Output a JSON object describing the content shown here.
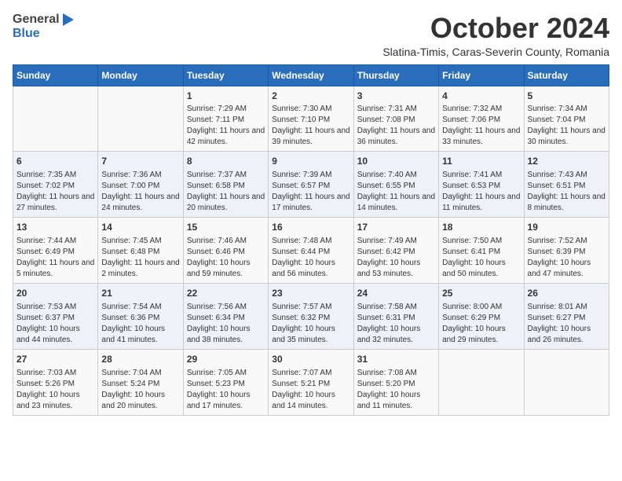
{
  "logo": {
    "line1": "General",
    "line2": "Blue"
  },
  "title": "October 2024",
  "subtitle": "Slatina-Timis, Caras-Severin County, Romania",
  "weekdays": [
    "Sunday",
    "Monday",
    "Tuesday",
    "Wednesday",
    "Thursday",
    "Friday",
    "Saturday"
  ],
  "weeks": [
    [
      {
        "day": "",
        "info": ""
      },
      {
        "day": "",
        "info": ""
      },
      {
        "day": "1",
        "info": "Sunrise: 7:29 AM\nSunset: 7:11 PM\nDaylight: 11 hours and 42 minutes."
      },
      {
        "day": "2",
        "info": "Sunrise: 7:30 AM\nSunset: 7:10 PM\nDaylight: 11 hours and 39 minutes."
      },
      {
        "day": "3",
        "info": "Sunrise: 7:31 AM\nSunset: 7:08 PM\nDaylight: 11 hours and 36 minutes."
      },
      {
        "day": "4",
        "info": "Sunrise: 7:32 AM\nSunset: 7:06 PM\nDaylight: 11 hours and 33 minutes."
      },
      {
        "day": "5",
        "info": "Sunrise: 7:34 AM\nSunset: 7:04 PM\nDaylight: 11 hours and 30 minutes."
      }
    ],
    [
      {
        "day": "6",
        "info": "Sunrise: 7:35 AM\nSunset: 7:02 PM\nDaylight: 11 hours and 27 minutes."
      },
      {
        "day": "7",
        "info": "Sunrise: 7:36 AM\nSunset: 7:00 PM\nDaylight: 11 hours and 24 minutes."
      },
      {
        "day": "8",
        "info": "Sunrise: 7:37 AM\nSunset: 6:58 PM\nDaylight: 11 hours and 20 minutes."
      },
      {
        "day": "9",
        "info": "Sunrise: 7:39 AM\nSunset: 6:57 PM\nDaylight: 11 hours and 17 minutes."
      },
      {
        "day": "10",
        "info": "Sunrise: 7:40 AM\nSunset: 6:55 PM\nDaylight: 11 hours and 14 minutes."
      },
      {
        "day": "11",
        "info": "Sunrise: 7:41 AM\nSunset: 6:53 PM\nDaylight: 11 hours and 11 minutes."
      },
      {
        "day": "12",
        "info": "Sunrise: 7:43 AM\nSunset: 6:51 PM\nDaylight: 11 hours and 8 minutes."
      }
    ],
    [
      {
        "day": "13",
        "info": "Sunrise: 7:44 AM\nSunset: 6:49 PM\nDaylight: 11 hours and 5 minutes."
      },
      {
        "day": "14",
        "info": "Sunrise: 7:45 AM\nSunset: 6:48 PM\nDaylight: 11 hours and 2 minutes."
      },
      {
        "day": "15",
        "info": "Sunrise: 7:46 AM\nSunset: 6:46 PM\nDaylight: 10 hours and 59 minutes."
      },
      {
        "day": "16",
        "info": "Sunrise: 7:48 AM\nSunset: 6:44 PM\nDaylight: 10 hours and 56 minutes."
      },
      {
        "day": "17",
        "info": "Sunrise: 7:49 AM\nSunset: 6:42 PM\nDaylight: 10 hours and 53 minutes."
      },
      {
        "day": "18",
        "info": "Sunrise: 7:50 AM\nSunset: 6:41 PM\nDaylight: 10 hours and 50 minutes."
      },
      {
        "day": "19",
        "info": "Sunrise: 7:52 AM\nSunset: 6:39 PM\nDaylight: 10 hours and 47 minutes."
      }
    ],
    [
      {
        "day": "20",
        "info": "Sunrise: 7:53 AM\nSunset: 6:37 PM\nDaylight: 10 hours and 44 minutes."
      },
      {
        "day": "21",
        "info": "Sunrise: 7:54 AM\nSunset: 6:36 PM\nDaylight: 10 hours and 41 minutes."
      },
      {
        "day": "22",
        "info": "Sunrise: 7:56 AM\nSunset: 6:34 PM\nDaylight: 10 hours and 38 minutes."
      },
      {
        "day": "23",
        "info": "Sunrise: 7:57 AM\nSunset: 6:32 PM\nDaylight: 10 hours and 35 minutes."
      },
      {
        "day": "24",
        "info": "Sunrise: 7:58 AM\nSunset: 6:31 PM\nDaylight: 10 hours and 32 minutes."
      },
      {
        "day": "25",
        "info": "Sunrise: 8:00 AM\nSunset: 6:29 PM\nDaylight: 10 hours and 29 minutes."
      },
      {
        "day": "26",
        "info": "Sunrise: 8:01 AM\nSunset: 6:27 PM\nDaylight: 10 hours and 26 minutes."
      }
    ],
    [
      {
        "day": "27",
        "info": "Sunrise: 7:03 AM\nSunset: 5:26 PM\nDaylight: 10 hours and 23 minutes."
      },
      {
        "day": "28",
        "info": "Sunrise: 7:04 AM\nSunset: 5:24 PM\nDaylight: 10 hours and 20 minutes."
      },
      {
        "day": "29",
        "info": "Sunrise: 7:05 AM\nSunset: 5:23 PM\nDaylight: 10 hours and 17 minutes."
      },
      {
        "day": "30",
        "info": "Sunrise: 7:07 AM\nSunset: 5:21 PM\nDaylight: 10 hours and 14 minutes."
      },
      {
        "day": "31",
        "info": "Sunrise: 7:08 AM\nSunset: 5:20 PM\nDaylight: 10 hours and 11 minutes."
      },
      {
        "day": "",
        "info": ""
      },
      {
        "day": "",
        "info": ""
      }
    ]
  ]
}
